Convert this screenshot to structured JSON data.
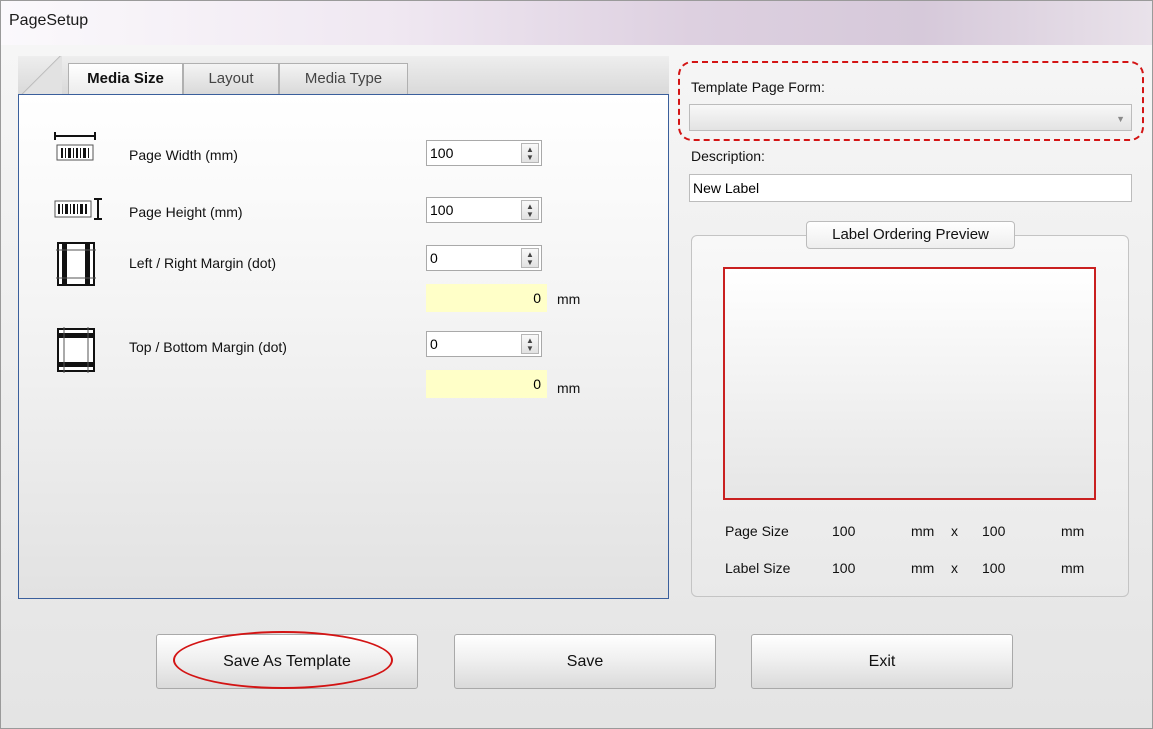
{
  "window": {
    "title": "PageSetup"
  },
  "tabs": [
    {
      "label": "Media Size",
      "active": true
    },
    {
      "label": "Layout",
      "active": false
    },
    {
      "label": "Media Type",
      "active": false
    }
  ],
  "media_size": {
    "page_width": {
      "label": "Page Width (mm)",
      "value": "100",
      "icon": "page-width-icon"
    },
    "page_height": {
      "label": "Page Height (mm)",
      "value": "100",
      "icon": "page-height-icon"
    },
    "lr_margin": {
      "label": "Left / Right Margin (dot)",
      "value": "0",
      "mm_value": "0",
      "unit": "mm",
      "icon": "left-right-margin-icon"
    },
    "tb_margin": {
      "label": "Top / Bottom Margin (dot)",
      "value": "0",
      "mm_value": "0",
      "unit": "mm",
      "icon": "top-bottom-margin-icon"
    }
  },
  "template": {
    "label": "Template Page Form:",
    "value": "",
    "description_label": "Description:",
    "description_value": "New Label"
  },
  "preview": {
    "title": "Label Ordering Preview",
    "page_size_label": "Page Size",
    "page_size_w": "100",
    "page_size_h": "100",
    "label_size_label": "Label Size",
    "label_size_w": "100",
    "label_size_h": "100",
    "unit": "mm",
    "times": "x"
  },
  "buttons": {
    "save_as_template": "Save As Template",
    "save": "Save",
    "exit": "Exit"
  },
  "colors": {
    "highlight_red": "#d31414",
    "mm_field_bg": "#ffffc8",
    "pane_border": "#3a5f9c"
  }
}
